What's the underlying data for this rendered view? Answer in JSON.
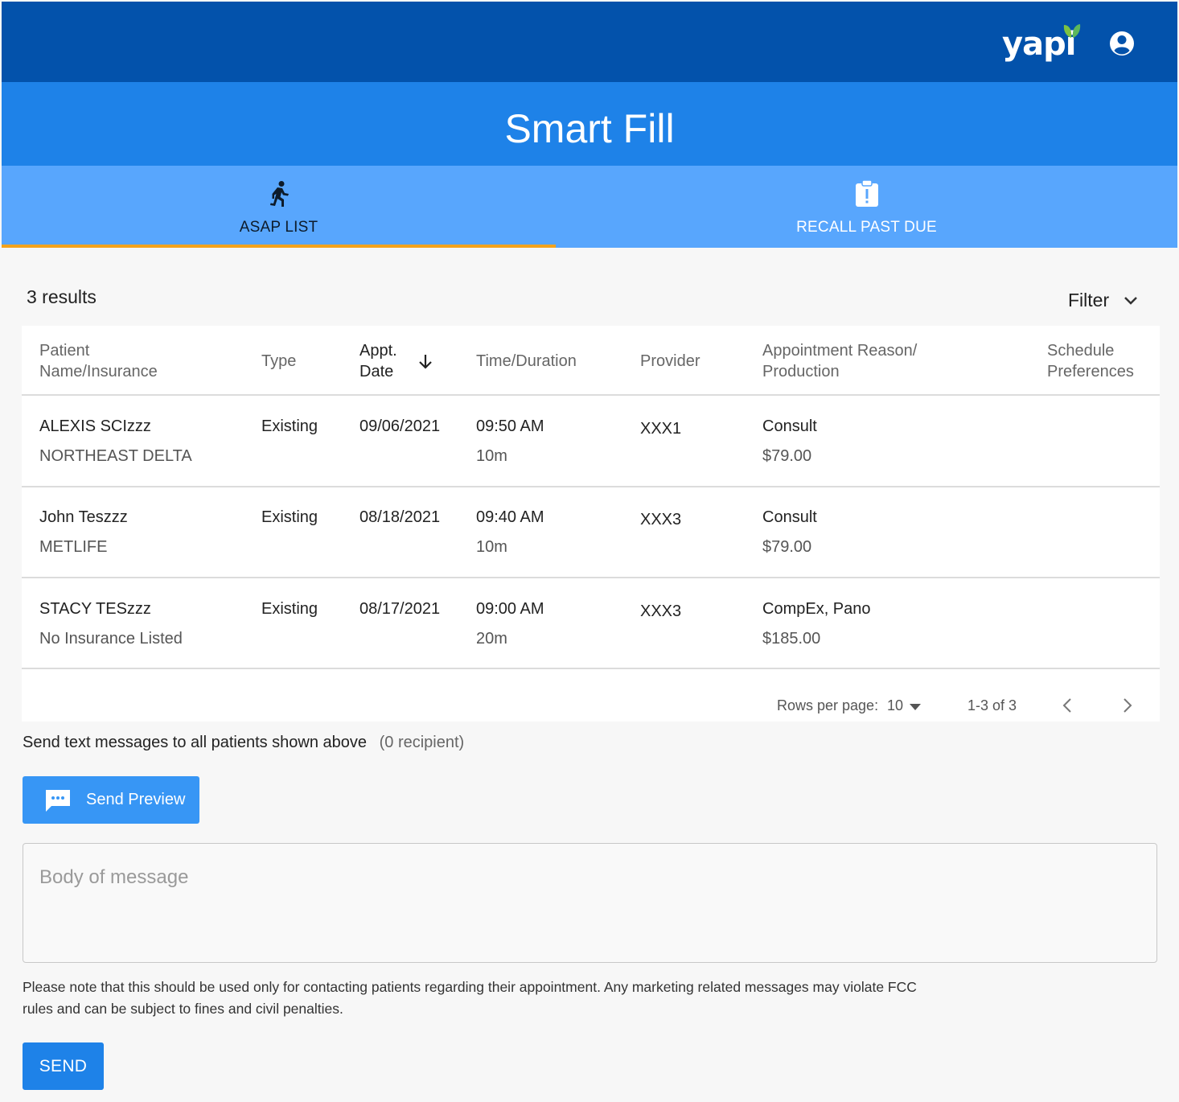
{
  "header": {
    "logo_text": "yapi",
    "brand_color": "#0352ab",
    "leaf_color": "#5cb85c",
    "user_icon": "account-circle-icon"
  },
  "page": {
    "title": "Smart Fill",
    "title_bar_color": "#1e82e8"
  },
  "tabs": [
    {
      "label": "ASAP LIST",
      "icon": "running-person-icon",
      "active": true
    },
    {
      "label": "RECALL PAST DUE",
      "icon": "clipboard-alert-icon",
      "active": false
    }
  ],
  "results": {
    "count_text": "3 results",
    "filter_label": "Filter"
  },
  "table": {
    "headers": {
      "patient_line1": "Patient",
      "patient_line2": "Name/Insurance",
      "type": "Type",
      "date_line1": "Appt.",
      "date_line2": "Date",
      "time": "Time/Duration",
      "provider": "Provider",
      "reason_line1": "Appointment Reason/",
      "reason_line2": "Production",
      "prefs_line1": "Schedule",
      "prefs_line2": "Preferences"
    },
    "sort": {
      "column": "Appt. Date",
      "direction": "descending"
    },
    "rows": [
      {
        "name": "ALEXIS SCIzzz",
        "insurance": "NORTHEAST DELTA",
        "type": "Existing",
        "date": "09/06/2021",
        "time": "09:50 AM",
        "duration": "10m",
        "provider": "XXX1",
        "reason": "Consult",
        "production": "$79.00"
      },
      {
        "name": "John Teszzz",
        "insurance": "METLIFE",
        "type": "Existing",
        "date": "08/18/2021",
        "time": "09:40 AM",
        "duration": "10m",
        "provider": "XXX3",
        "reason": "Consult",
        "production": "$79.00"
      },
      {
        "name": "STACY TESzzz",
        "insurance": "No Insurance Listed",
        "type": "Existing",
        "date": "08/17/2021",
        "time": "09:00 AM",
        "duration": "20m",
        "provider": "XXX3",
        "reason": "CompEx, Pano",
        "production": "$185.00"
      }
    ],
    "pagination": {
      "rows_per_page_label": "Rows per page:",
      "rows_per_page_value": "10",
      "range_text": "1-3 of 3"
    }
  },
  "messaging": {
    "send_all_text": "Send text messages to all patients shown above",
    "recipient_text": "(0 recipient)",
    "preview_button_label": "Send Preview",
    "body_placeholder": "Body of message",
    "notice_text": "Please note that this should be used only for contacting patients regarding their appointment. Any marketing related messages may violate FCC rules and can be subject to fines and civil penalties.",
    "send_button_label": "SEND",
    "button_color": "#1e82e8"
  }
}
